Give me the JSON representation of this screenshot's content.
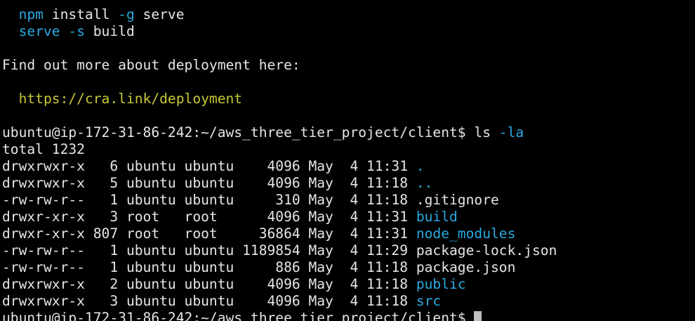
{
  "install": {
    "indent": "  ",
    "npm_cmd": "npm",
    "npm_rest": " install ",
    "npm_flag": "-g",
    "npm_pkg": " serve",
    "serve_cmd": "serve",
    "serve_space": " ",
    "serve_flag": "-s",
    "serve_arg": " build"
  },
  "deploy": {
    "text": "Find out more about deployment here:",
    "link": "https://cra.link/deployment"
  },
  "prompt": {
    "text": "ubuntu@ip-172-31-86-242:~/aws_three_tier_project/client$",
    "command": " ls ",
    "flag": "-la"
  },
  "total": "total 1232",
  "listing": [
    {
      "meta": "drwxrwxr-x   6 ubuntu ubuntu    4096 May  4 11:31 ",
      "name": ".",
      "kind": "dir"
    },
    {
      "meta": "drwxrwxr-x   5 ubuntu ubuntu    4096 May  4 11:18 ",
      "name": "..",
      "kind": "dir"
    },
    {
      "meta": "-rw-rw-r--   1 ubuntu ubuntu     310 May  4 11:18 ",
      "name": ".gitignore",
      "kind": "file"
    },
    {
      "meta": "drwxr-xr-x   3 root   root      4096 May  4 11:31 ",
      "name": "build",
      "kind": "dir"
    },
    {
      "meta": "drwxr-xr-x 807 root   root     36864 May  4 11:31 ",
      "name": "node_modules",
      "kind": "dir"
    },
    {
      "meta": "-rw-rw-r--   1 ubuntu ubuntu 1189854 May  4 11:29 ",
      "name": "package-lock.json",
      "kind": "file"
    },
    {
      "meta": "-rw-rw-r--   1 ubuntu ubuntu     886 May  4 11:18 ",
      "name": "package.json",
      "kind": "file"
    },
    {
      "meta": "drwxrwxr-x   2 ubuntu ubuntu    4096 May  4 11:18 ",
      "name": "public",
      "kind": "dir"
    },
    {
      "meta": "drwxrwxr-x   3 ubuntu ubuntu    4096 May  4 11:18 ",
      "name": "src",
      "kind": "dir"
    }
  ],
  "final_prompt": {
    "text": "ubuntu@ip-172-31-86-242:~/aws_three_tier_project/client$",
    "space": " "
  },
  "colors": {
    "background": "#000000",
    "foreground": "#e6e6e6",
    "directory": "#29a9e0",
    "link": "#c8c837",
    "cursor": "#bfbfbf"
  }
}
